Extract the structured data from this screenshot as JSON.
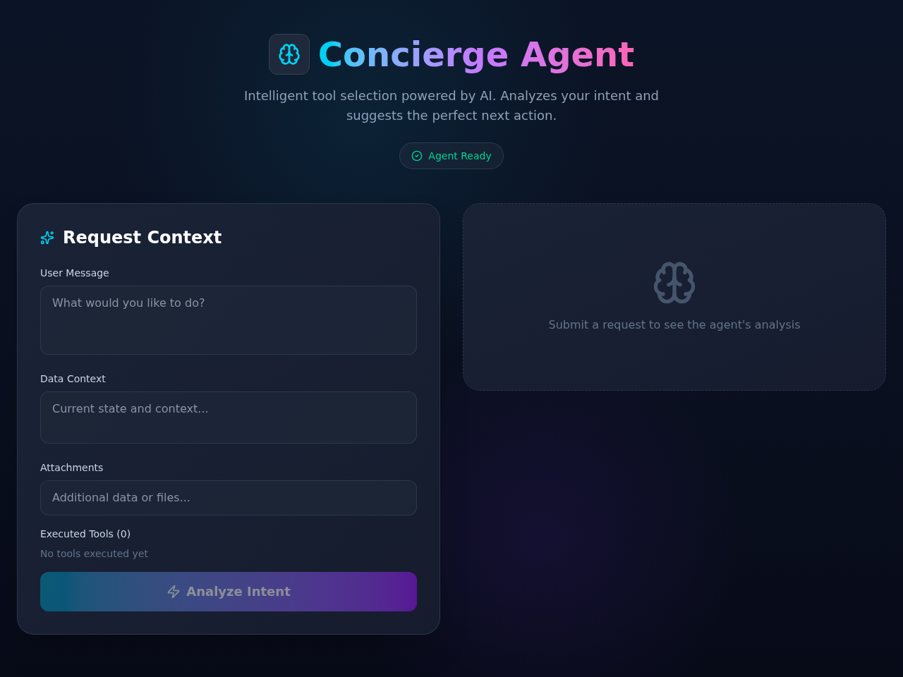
{
  "header": {
    "title": "Concierge Agent",
    "subtitle": "Intelligent tool selection powered by AI. Analyzes your intent and suggests the perfect next action.",
    "status": {
      "label": "Agent Ready",
      "ready": true
    }
  },
  "request_panel": {
    "title": "Request Context",
    "fields": [
      {
        "kind": "textarea",
        "label": "User Message",
        "placeholder": "What would you like to do?"
      },
      {
        "kind": "textarea",
        "label": "Data Context",
        "placeholder": "Current state and context..."
      },
      {
        "kind": "input",
        "label": "Attachments",
        "placeholder": "Additional data or files..."
      }
    ],
    "executed_tools": {
      "label": "Executed Tools (0)",
      "empty_text": "No tools executed yet"
    },
    "submit_button": {
      "label": "Analyze Intent",
      "disabled": true
    }
  },
  "analysis_panel": {
    "empty_text": "Submit a request to see the agent's analysis"
  }
}
